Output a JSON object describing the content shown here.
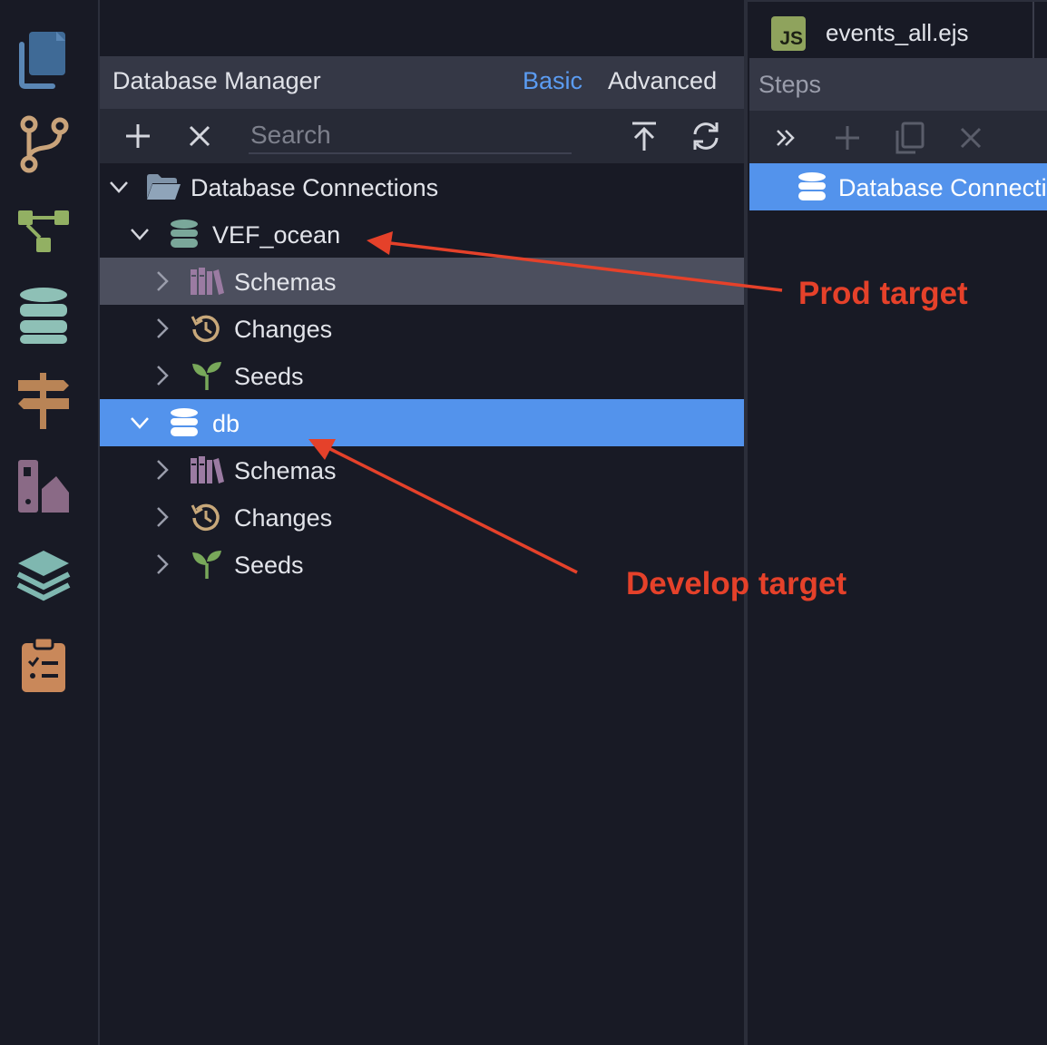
{
  "activity_bar": {
    "items": [
      {
        "icon": "files-icon",
        "color": "#5a86b4"
      },
      {
        "icon": "git-branch-icon",
        "color": "#c9a37a"
      },
      {
        "icon": "diagram-icon",
        "color": "#92b063"
      },
      {
        "icon": "database-icon",
        "color": "#8ec0b6"
      },
      {
        "icon": "signpost-icon",
        "color": "#b98456"
      },
      {
        "icon": "swatch-icon",
        "color": "#8a6a86"
      },
      {
        "icon": "layers-icon",
        "color": "#7fb7b0"
      },
      {
        "icon": "clipboard-icon",
        "color": "#c9885a"
      }
    ]
  },
  "db_manager": {
    "title": "Database Manager",
    "mode_basic": "Basic",
    "mode_advanced": "Advanced",
    "search_placeholder": "Search",
    "tree": {
      "root": "Database Connections",
      "connections": [
        {
          "name": "VEF_ocean",
          "children": [
            "Schemas",
            "Changes",
            "Seeds"
          ]
        },
        {
          "name": "db",
          "children": [
            "Schemas",
            "Changes",
            "Seeds"
          ]
        }
      ]
    }
  },
  "editor": {
    "tab_badge": "JS",
    "tab_file": "events_all.ejs"
  },
  "steps": {
    "title": "Steps",
    "item_label": "Database Connecti"
  },
  "annotations": {
    "prod": "Prod target",
    "develop": "Develop target",
    "color": "#e5412a"
  }
}
